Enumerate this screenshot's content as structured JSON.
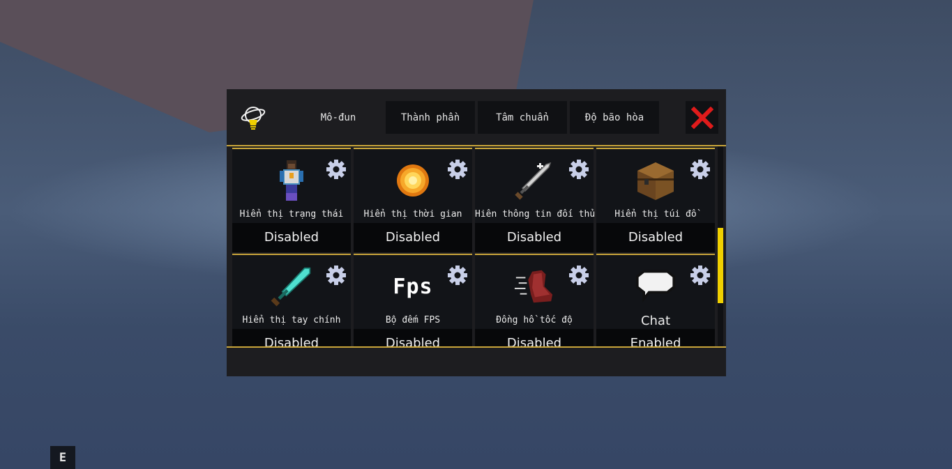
{
  "hint_key": "E",
  "tabs": [
    {
      "label": "Mô-đun",
      "active": true
    },
    {
      "label": "Thành phần",
      "active": false
    },
    {
      "label": "Tâm chuẩn",
      "active": false
    },
    {
      "label": "Độ bão hòa",
      "active": false
    }
  ],
  "modules": [
    {
      "name": "Hiển thị trạng thái",
      "status": "Disabled",
      "icon": "armor-stand-icon"
    },
    {
      "name": "Hiển thị thời gian",
      "status": "Disabled",
      "icon": "sun-icon"
    },
    {
      "name": "Hiên thông tin đối thủ",
      "status": "Disabled",
      "icon": "sword-icon"
    },
    {
      "name": "Hiển thị túi đồ",
      "status": "Disabled",
      "icon": "chest-icon"
    },
    {
      "name": "Hiển thị tay chính",
      "status": "Disabled",
      "icon": "diamond-sword-icon"
    },
    {
      "name": "Bộ đếm FPS",
      "status": "Disabled",
      "icon": "fps-icon",
      "icon_text": "Fps"
    },
    {
      "name": "Đồng hồ tốc độ",
      "status": "Disabled",
      "icon": "speed-boot-icon"
    },
    {
      "name": "Chat",
      "status": "Enabled",
      "icon": "chat-bubble-icon"
    }
  ],
  "colors": {
    "accent": "#c9a53a",
    "scrollbar": "#f0d000",
    "close": "#e01b1b"
  }
}
